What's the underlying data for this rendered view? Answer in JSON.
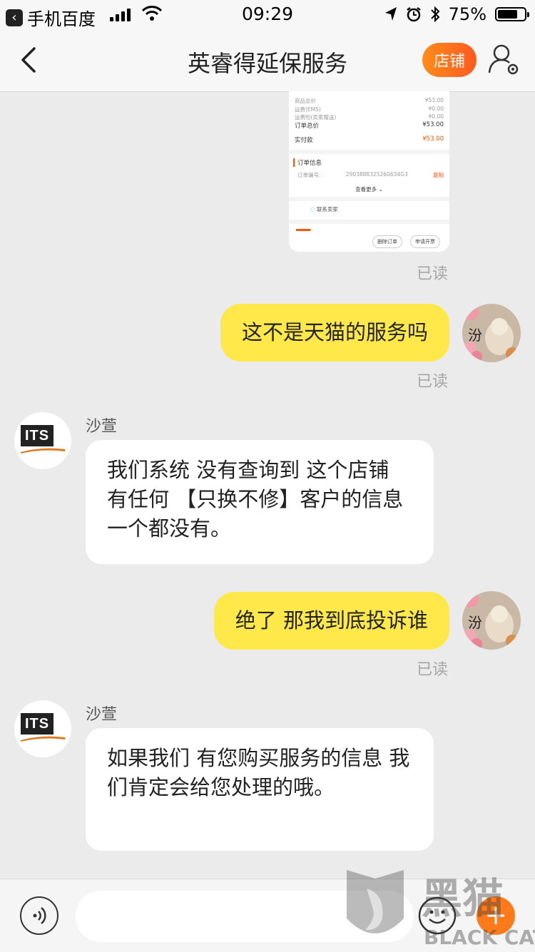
{
  "status_bar": {
    "back_app": "手机百度",
    "time": "09:29",
    "battery": "75%",
    "battery_level": 0.75
  },
  "nav": {
    "title": "英睿得延保服务",
    "shop_button": "店铺"
  },
  "order_card": {
    "rows": [
      {
        "label": "商品总价",
        "value": "¥53.00"
      },
      {
        "label": "运费(EMS)",
        "value": "¥0.00"
      },
      {
        "label": "运费险(卖家赠送)",
        "value": "¥0.00"
      }
    ],
    "total_label": "订单总价",
    "total_value": "¥53.00",
    "paid_label": "实付款",
    "paid_value": "¥53.00",
    "info_title": "订单信息",
    "order_no_label": "订单编号:",
    "order_no": "2903888325260634G3",
    "copy": "复制",
    "more": "查看更多",
    "contact": "联系卖家",
    "delete_order": "删除订单",
    "invoice": "申请开票"
  },
  "messages": [
    {
      "side": "me",
      "text": "这不是天猫的服务吗",
      "read": "已读",
      "avatar_text": "汾"
    },
    {
      "side": "them",
      "sender": "沙萱",
      "text": "我们系统 没有查询到 这个店铺 有任何 【只换不修】客户的信息 一个都没有。"
    },
    {
      "side": "me",
      "text": "绝了 那我到底投诉谁",
      "read": "已读",
      "avatar_text": "汾"
    },
    {
      "side": "them",
      "sender": "沙萱",
      "text": "如果我们 有您购买服务的信息 我们肯定会给您处理的哦。"
    }
  ],
  "first_read": "已读",
  "seller_logo": "ITS",
  "input": {
    "placeholder": ""
  },
  "watermark": {
    "cn": "黑猫",
    "en": "BLACK CAT"
  },
  "icons": {
    "back": "chevron-left-icon",
    "profile": "user-settings-icon",
    "voice": "voice-icon",
    "emoji": "emoji-icon",
    "plus": "plus-icon"
  },
  "colors": {
    "my_bubble": "#ffe94a",
    "shop_button": "#ff6a1c",
    "background": "#ebebeb"
  }
}
